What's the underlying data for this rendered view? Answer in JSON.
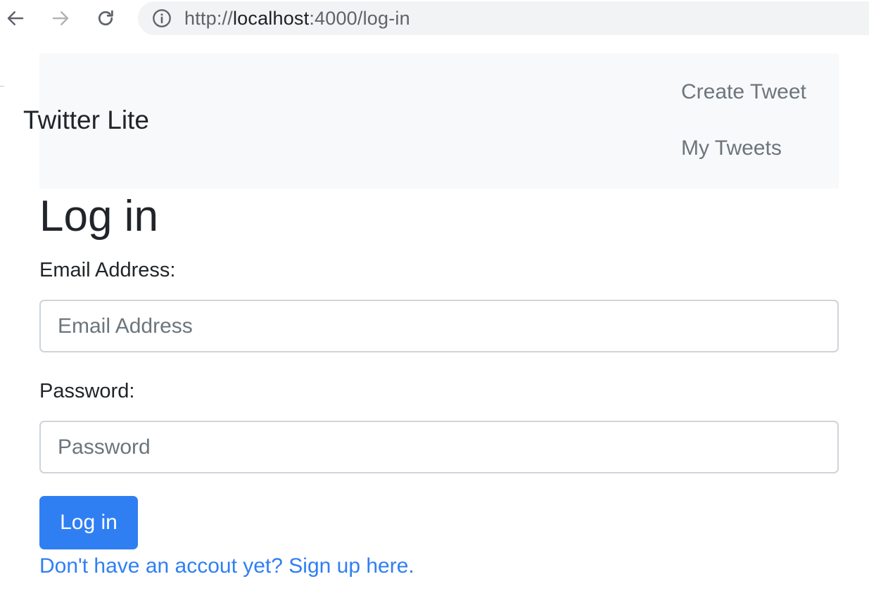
{
  "browser": {
    "url_prefix": "http://",
    "url_host": "localhost",
    "url_rest": ":4000/log-in",
    "icons": {
      "back": "arrow-left-icon",
      "forward": "arrow-right-icon",
      "reload": "reload-icon",
      "info": "info-icon"
    }
  },
  "navbar": {
    "brand": "Twitter Lite",
    "links": [
      {
        "label": "Create Tweet"
      },
      {
        "label": "My Tweets"
      }
    ]
  },
  "form": {
    "title": "Log in",
    "email_label": "Email Address:",
    "email_placeholder": "Email Address",
    "email_value": "",
    "password_label": "Password:",
    "password_placeholder": "Password",
    "password_value": "",
    "submit_label": "Log in",
    "signup_text": "Don't have an accout yet? Sign up here."
  },
  "colors": {
    "primary": "#2f7ff3",
    "navbar_bg": "#f8f9fa",
    "muted_text": "#6c757d",
    "url_bar_bg": "#f1f3f4"
  }
}
